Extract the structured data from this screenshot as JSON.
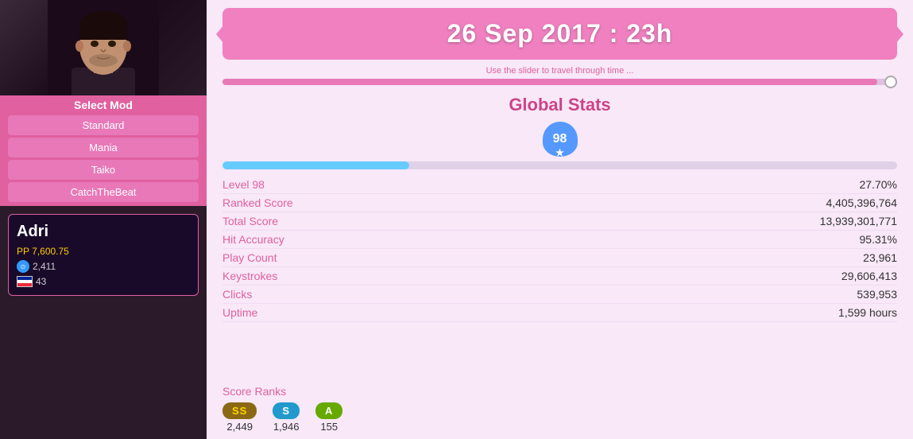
{
  "sidebar": {
    "mod_title": "Select Mod",
    "mod_buttons": [
      "Standard",
      "Mania",
      "Taiko",
      "CatchTheBeat"
    ],
    "user": {
      "name": "Adri",
      "pp_label": "PP",
      "pp_value": "7,600.75",
      "global_rank": "2,411",
      "country_rank": "43"
    }
  },
  "header": {
    "date": "26 Sep 2017 : 23h",
    "slider_hint": "Use the slider to travel through time ..."
  },
  "stats": {
    "title": "Global Stats",
    "level": "98",
    "level_progress": "27.70%",
    "xp_percent": 27.7,
    "rows": [
      {
        "label": "Level 98",
        "value": "27.70%"
      },
      {
        "label": "Ranked Score",
        "value": "4,405,396,764"
      },
      {
        "label": "Total Score",
        "value": "13,939,301,771"
      },
      {
        "label": "Hit Accuracy",
        "value": "95.31%"
      },
      {
        "label": "Play Count",
        "value": "23,961"
      },
      {
        "label": "Keystrokes",
        "value": "29,606,413"
      },
      {
        "label": "Clicks",
        "value": "539,953"
      },
      {
        "label": "Uptime",
        "value": "1,599 hours"
      }
    ],
    "score_ranks": {
      "title": "Score Ranks",
      "items": [
        {
          "badge": "SS",
          "count": "2,449",
          "type": "ss"
        },
        {
          "badge": "S",
          "count": "1,946",
          "type": "s"
        },
        {
          "badge": "A",
          "count": "155",
          "type": "a"
        }
      ]
    }
  }
}
